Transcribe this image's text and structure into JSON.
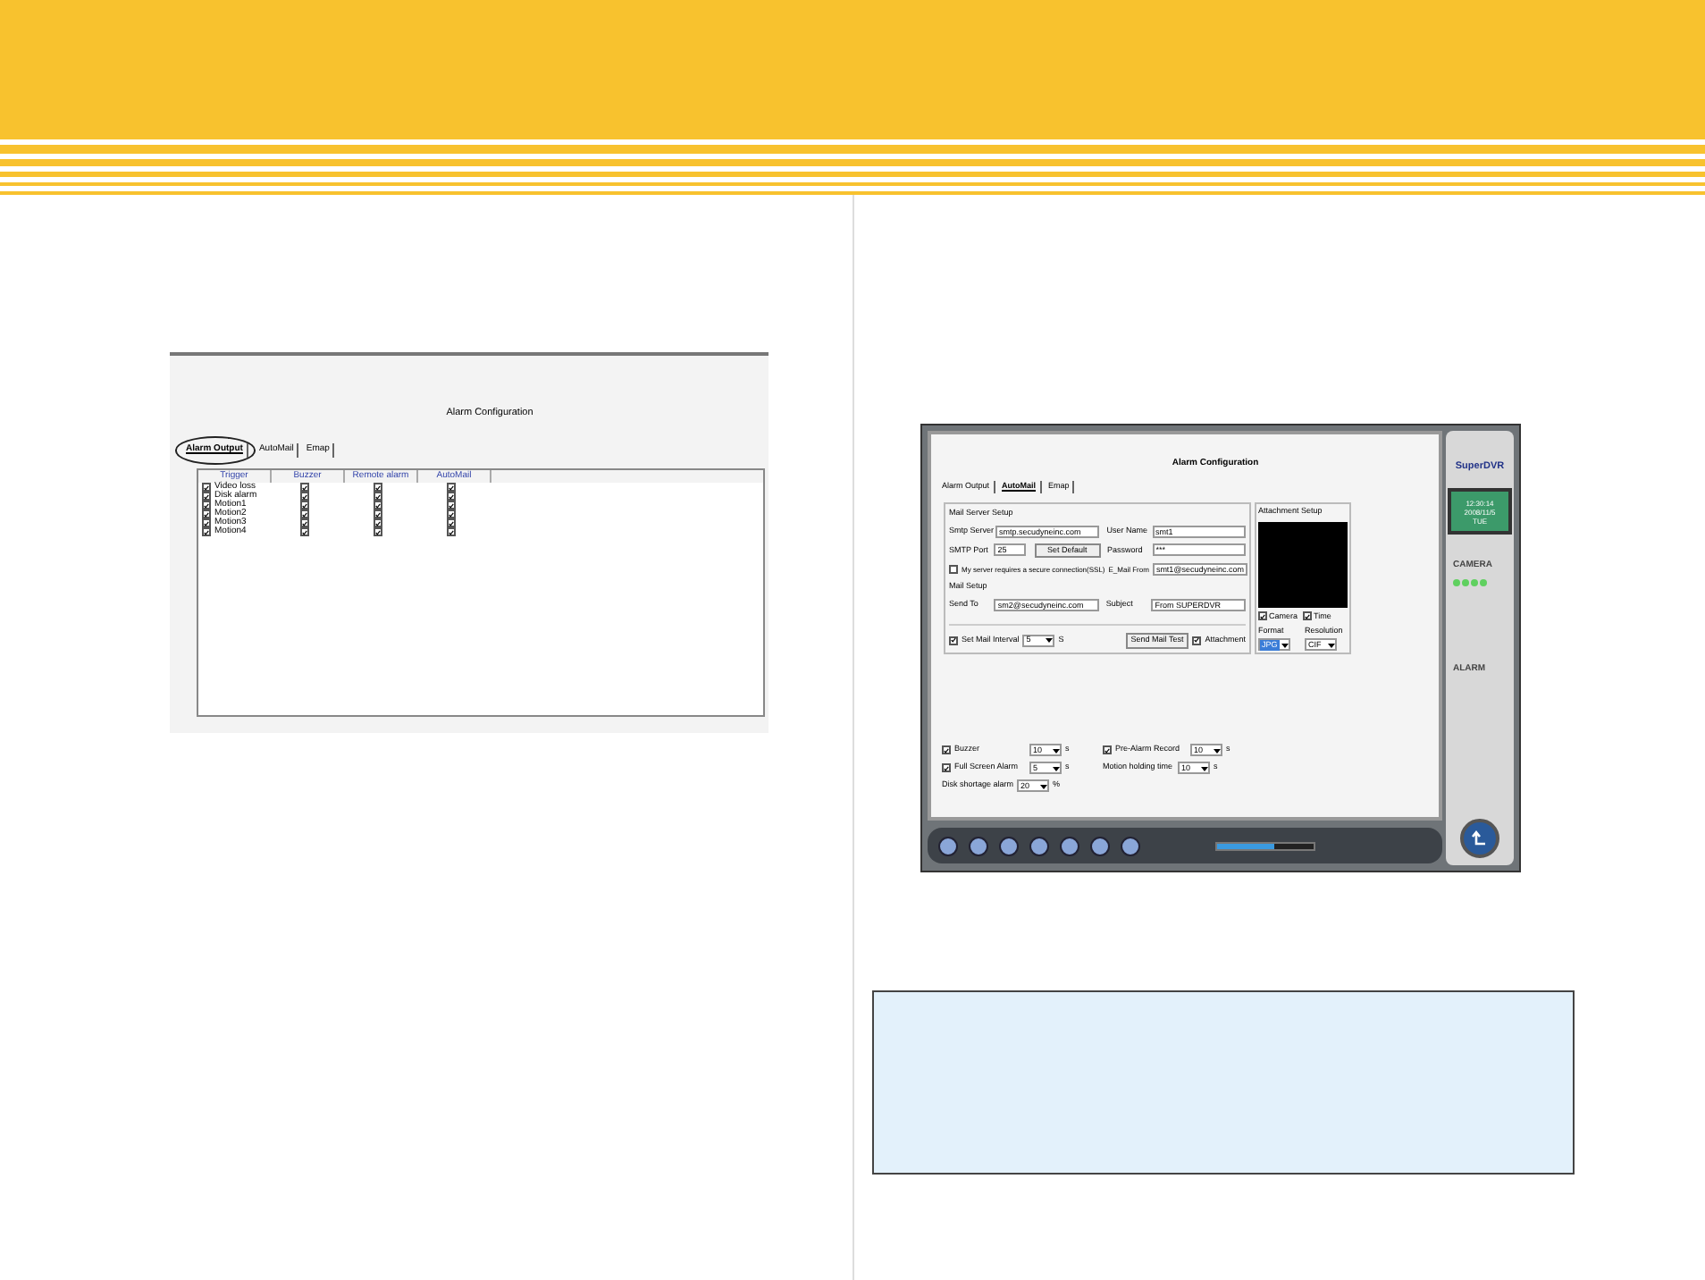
{
  "left_window": {
    "title": "Alarm Configuration",
    "tabs": [
      {
        "label": "Alarm Output",
        "selected": true
      },
      {
        "label": "AutoMail",
        "selected": false
      },
      {
        "label": "Emap",
        "selected": false
      }
    ],
    "columns": [
      "Trigger",
      "Buzzer",
      "Remote alarm",
      "AutoMail"
    ],
    "rows": [
      {
        "name": "Video loss",
        "trigger": true,
        "buzzer": true,
        "remote": true,
        "automail": true
      },
      {
        "name": "Disk alarm",
        "trigger": true,
        "buzzer": true,
        "remote": true,
        "automail": true
      },
      {
        "name": "Motion1",
        "trigger": true,
        "buzzer": true,
        "remote": true,
        "automail": true
      },
      {
        "name": "Motion2",
        "trigger": true,
        "buzzer": true,
        "remote": true,
        "automail": true
      },
      {
        "name": "Motion3",
        "trigger": true,
        "buzzer": true,
        "remote": true,
        "automail": true
      },
      {
        "name": "Motion4",
        "trigger": true,
        "buzzer": true,
        "remote": true,
        "automail": true
      }
    ]
  },
  "dvr_window": {
    "title": "Alarm Configuration",
    "tabs": [
      {
        "label": "Alarm Output",
        "selected": false
      },
      {
        "label": "AutoMail",
        "selected": true
      },
      {
        "label": "Emap",
        "selected": false
      }
    ],
    "mail_server": {
      "legend": "Mail Server Setup",
      "smtp_server_label": "Smtp Server",
      "smtp_server": "smtp.secudyneinc.com",
      "user_name_label": "User Name",
      "user_name": "smt1",
      "port_label": "SMTP Port",
      "port": "25",
      "set_default": "Set Default",
      "password_label": "Password",
      "password": "***",
      "ssl_label": "My server requires a secure connection(SSL)",
      "ssl_checked": false,
      "from_label": "E_Mail From",
      "from": "smt1@secudyneinc.com"
    },
    "mail_setup": {
      "legend": "Mail Setup",
      "send_to_label": "Send To",
      "send_to": "sm2@secudyneinc.com",
      "subject_label": "Subject",
      "subject": "From SUPERDVR",
      "interval_label": "Set Mail Interval",
      "interval_checked": true,
      "interval": "5",
      "interval_unit": "S",
      "test_button": "Send Mail Test",
      "attachment_label": "Attachment",
      "attachment_checked": true
    },
    "attachment_setup": {
      "legend": "Attachment Setup",
      "camera_label": "Camera",
      "camera_checked": true,
      "time_label": "Time",
      "time_checked": true,
      "format_label": "Format",
      "format": "JPG",
      "resolution_label": "Resolution",
      "resolution": "CIF"
    },
    "options": [
      {
        "label": "Buzzer",
        "checked": true,
        "value": "10",
        "unit": "s"
      },
      {
        "label": "Pre-Alarm Record",
        "checked": true,
        "value": "10",
        "unit": "s"
      },
      {
        "label": "Full Screen Alarm",
        "checked": true,
        "value": "5",
        "unit": "s"
      },
      {
        "label": "Motion holding time",
        "value": "10",
        "unit": "s"
      },
      {
        "label": "Disk shortage alarm",
        "value": "20",
        "unit": "%"
      }
    ],
    "brand": "SuperDVR",
    "clock": [
      "12:30:14",
      "2008/11/5",
      "TUE"
    ],
    "camera_label": "CAMERA",
    "alarm_label": "ALARM",
    "progress": {
      "level": 0.6
    }
  }
}
